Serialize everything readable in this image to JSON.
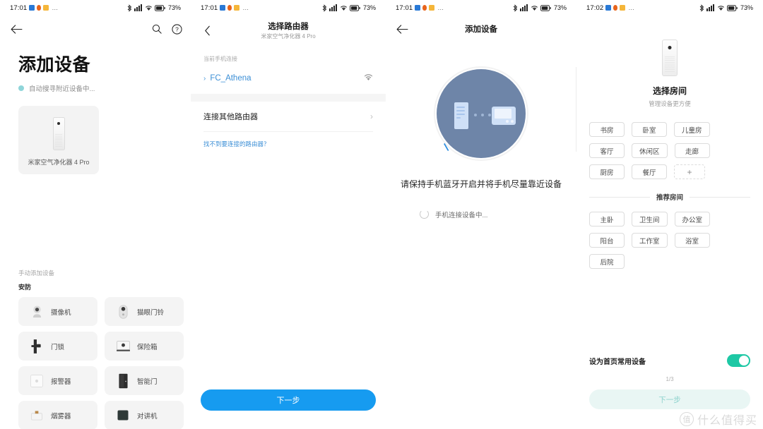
{
  "statusbar": {
    "time_1": "17:01",
    "time_2": "17:01",
    "time_3": "17:01",
    "time_4": "17:02",
    "battery": "73%",
    "overflow": "…"
  },
  "panel1": {
    "back_icon": "arrow-left-icon",
    "search_icon": "search-icon",
    "help_icon": "help-circle-icon",
    "title": "添加设备",
    "scanning_text": "自动搜寻附近设备中...",
    "found_device": "米家空气净化器 4 Pro",
    "manual_header": "手动添加设备",
    "category": "安防",
    "devices": [
      {
        "label": "摄像机",
        "icon": "camera-icon"
      },
      {
        "label": "猫眼门铃",
        "icon": "doorbell-icon"
      },
      {
        "label": "门锁",
        "icon": "door-lock-icon"
      },
      {
        "label": "保险箱",
        "icon": "safe-box-icon"
      },
      {
        "label": "报警器",
        "icon": "alarm-icon"
      },
      {
        "label": "智能门",
        "icon": "smart-door-icon"
      },
      {
        "label": "烟雾器",
        "icon": "smoke-detector-icon"
      },
      {
        "label": "对讲机",
        "icon": "intercom-icon"
      }
    ]
  },
  "panel2": {
    "back_icon": "chevron-left-icon",
    "title": "选择路由器",
    "subtitle": "米家空气净化器 4 Pro",
    "group_label": "当前手机连接",
    "ssid": "FC_Athena",
    "wifi_icon": "wifi-icon",
    "other_router": "连接其他路由器",
    "chevron_icon": "chevron-right-icon",
    "help_link": "找不到要连接的路由器？",
    "next_button": "下一步",
    "accent": "#169bf0"
  },
  "panel3": {
    "back_icon": "arrow-left-icon",
    "title": "添加设备",
    "instruction": "请保持手机蓝牙开启并将手机尽量靠近设备",
    "status_text": "手机连接设备中...",
    "spinner_icon": "loading-spinner-icon",
    "illustration_icon": "phone-to-device-bluetooth-illustration",
    "circle_color": "#6e85a8"
  },
  "panel4": {
    "device_icon": "air-purifier-icon",
    "title": "选择房间",
    "subtitle": "管理设备更方便",
    "rooms": [
      "书房",
      "卧室",
      "儿童房",
      "客厅",
      "休闲区",
      "走廊",
      "厨房",
      "餐厅"
    ],
    "add_room_icon": "plus-icon",
    "add_room_label": "+",
    "recommended_header": "推荐房间",
    "recommended": [
      "主卧",
      "卫生间",
      "办公室",
      "阳台",
      "工作室",
      "浴室",
      "后院"
    ],
    "toggle_label": "设为首页常用设备",
    "toggle_on": true,
    "toggle_color": "#1ec8a5",
    "page_indicator": "1/3",
    "next_button": "下一步",
    "watermark_mark": "值",
    "watermark_text": "什么值得买"
  }
}
